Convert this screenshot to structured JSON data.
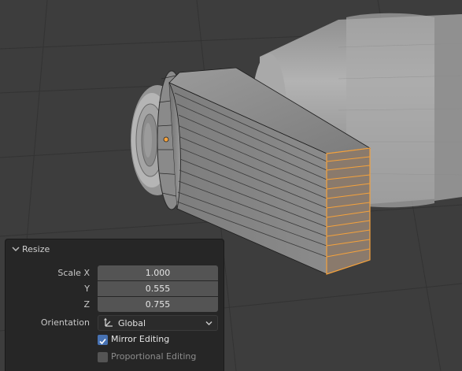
{
  "panel": {
    "title": "Resize",
    "scale_x_label": "Scale X",
    "scale_y_label": "Y",
    "scale_z_label": "Z",
    "scale_x": "1.000",
    "scale_y": "0.555",
    "scale_z": "0.755",
    "orientation_label": "Orientation",
    "orientation_value": "Global",
    "mirror_label": "Mirror Editing",
    "mirror_checked": true,
    "proportional_label": "Proportional Editing",
    "proportional_checked": false
  },
  "colors": {
    "viewport_bg": "#3d3d3d",
    "panel_bg": "#262626",
    "field_bg": "#545454",
    "selection": "#f5a23c",
    "checkbox_on": "#4772b3"
  },
  "icons": [
    "chevron-down-icon",
    "orientation-axes-icon",
    "dropdown-chevron-icon",
    "checkmark-icon"
  ]
}
